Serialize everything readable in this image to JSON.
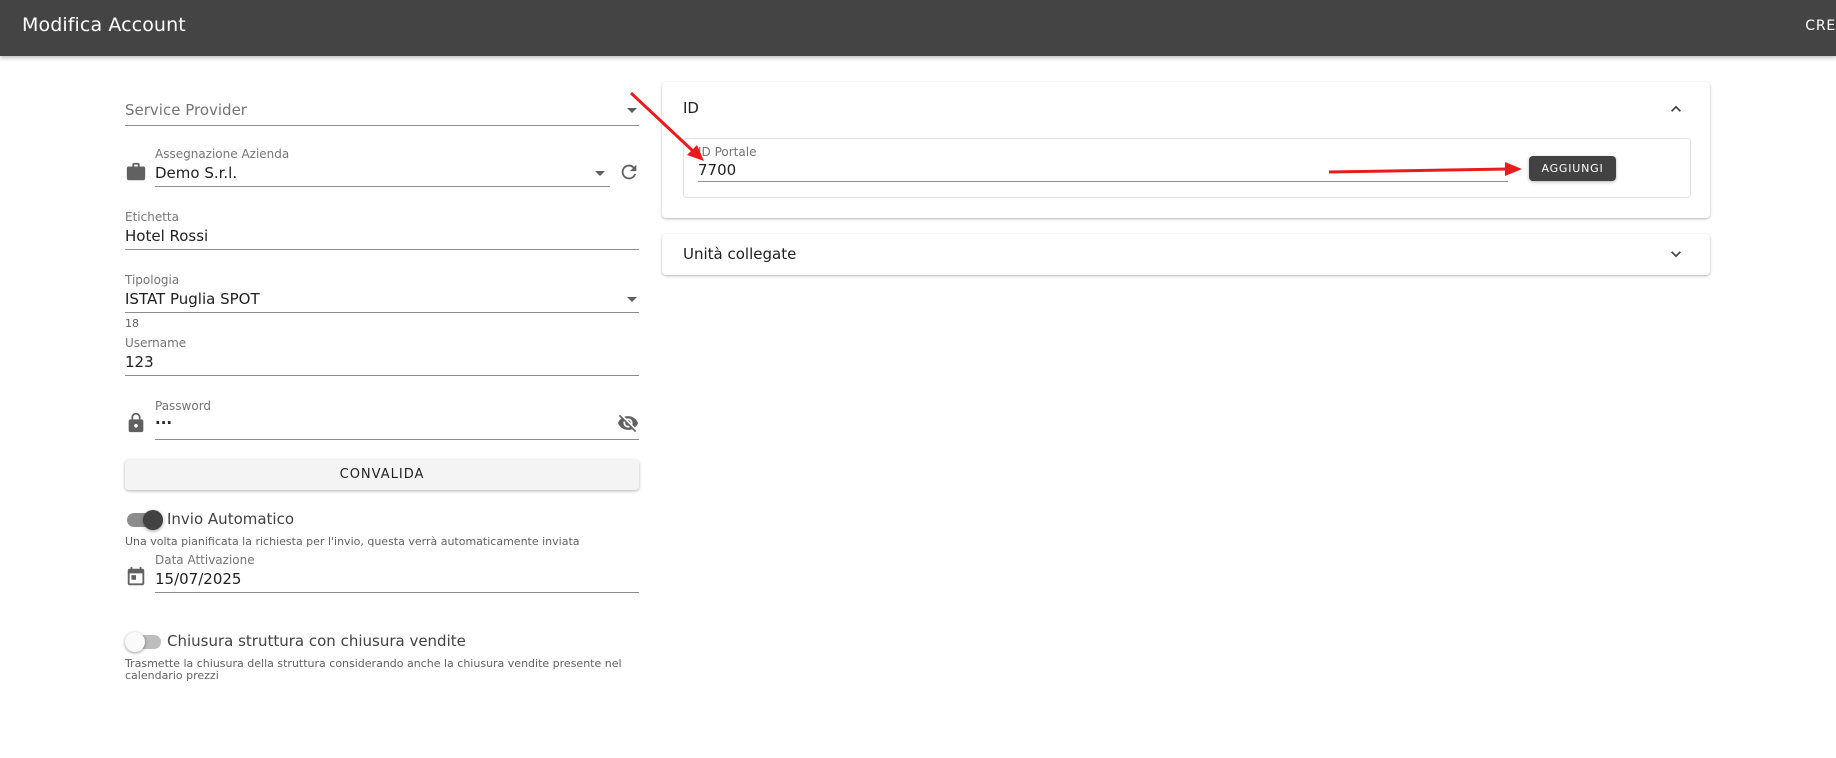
{
  "header": {
    "title": "Modifica Account",
    "action_label": "CRE"
  },
  "form": {
    "service_provider": {
      "placeholder": "Service Provider"
    },
    "assegnazione_azienda": {
      "label": "Assegnazione Azienda",
      "value": "Demo S.r.l."
    },
    "etichetta": {
      "label": "Etichetta",
      "value": "Hotel Rossi"
    },
    "tipologia": {
      "label": "Tipologia",
      "value": "ISTAT Puglia SPOT",
      "hint": "18"
    },
    "username": {
      "label": "Username",
      "value": "123"
    },
    "password": {
      "label": "Password",
      "value": "···"
    },
    "convalida_label": "CONVALIDA",
    "invio_automatico": {
      "label": "Invio Automatico",
      "on": true,
      "hint": "Una volta pianificata la richiesta per l'invio, questa verrà automaticamente inviata"
    },
    "data_attivazione": {
      "label": "Data Attivazione",
      "value": "15/07/2025"
    },
    "chiusura_struttura": {
      "label": "Chiusura struttura con chiusura vendite",
      "on": false,
      "hint": "Trasmette la chiusura della struttura considerando anche la chiusura vendite presente nel calendario prezzi"
    }
  },
  "id_panel": {
    "title": "ID",
    "expanded": true,
    "id_portale": {
      "label": "ID Portale",
      "value": "7700"
    },
    "add_button_label": "AGGIUNGI"
  },
  "unita_panel": {
    "title": "Unità collegate",
    "expanded": false
  },
  "colors": {
    "appbar": "#444444",
    "annotation_arrow": "#e81c1c",
    "button_dark": "#424242"
  },
  "icons": {
    "briefcase": "briefcase-icon",
    "refresh": "refresh-icon",
    "lock": "lock-icon",
    "visibility_off": "visibility-off-icon",
    "calendar": "calendar-icon",
    "chevron_up": "chevron-up-icon",
    "chevron_down": "chevron-down-icon"
  }
}
